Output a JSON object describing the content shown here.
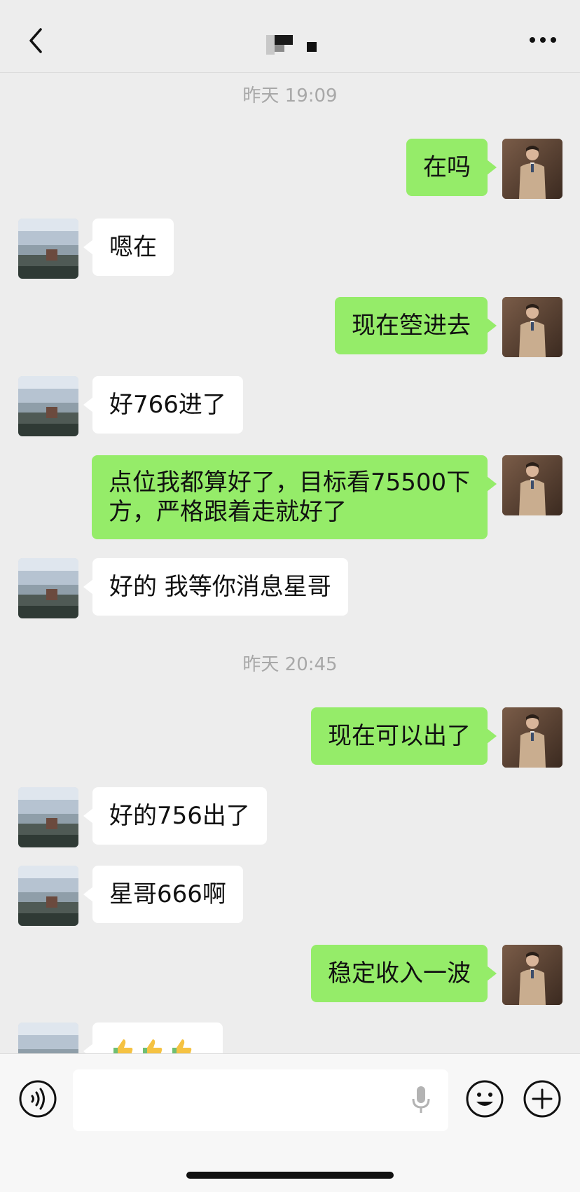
{
  "header": {
    "title_redacted": true,
    "back_icon": "chevron-left-icon",
    "more_icon": "more-dots-icon"
  },
  "timestamps": [
    "昨天 19:09",
    "昨天 20:45"
  ],
  "messages": [
    {
      "side": "out",
      "text": "在吗"
    },
    {
      "side": "in",
      "text": "嗯在"
    },
    {
      "side": "out",
      "text": "现在箜进去"
    },
    {
      "side": "in",
      "text": "好766进了"
    },
    {
      "side": "out",
      "line1": "点位我都算好了，目标看75500下",
      "line2": "方，严格跟着走就好了"
    },
    {
      "side": "in",
      "text": "好的 我等你消息星哥"
    },
    {
      "side": "out",
      "text": "现在可以出了"
    },
    {
      "side": "in",
      "text": "好的756出了"
    },
    {
      "side": "in",
      "text": "星哥666啊"
    },
    {
      "side": "out",
      "text": "稳定收入一波"
    },
    {
      "side": "in",
      "emoji": "thumbs-up x3"
    }
  ],
  "input_bar": {
    "voice_icon": "voice-icon",
    "mic_icon": "microphone-icon",
    "emoji_icon": "emoji-icon",
    "plus_icon": "plus-icon",
    "input_value": ""
  },
  "colors": {
    "background": "#ededed",
    "outgoing_bubble": "#95ec69",
    "incoming_bubble": "#ffffff",
    "timestamp": "#a8a8a8"
  }
}
